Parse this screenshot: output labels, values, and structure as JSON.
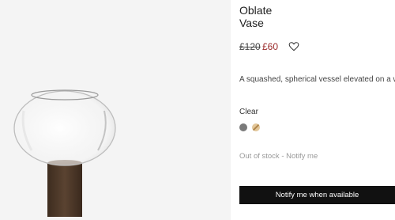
{
  "product": {
    "title_line1": "Oblate",
    "title_line2": "Vase",
    "price_original": "£120",
    "price_sale": "£60",
    "description": "A squashed, spherical vessel elevated on a wal",
    "variant_label": "Clear",
    "stock_status": "Out of stock - Notify me",
    "notify_button": "Notify me when available"
  },
  "icons": {
    "wishlist": "heart-outline-icon"
  },
  "colors": {
    "sale_price": "#9b2a2a",
    "button_bg": "#111111",
    "swatch_1": "#7a7a7a",
    "swatch_2": "#e3c79a",
    "walnut": "#4e3a2b"
  }
}
